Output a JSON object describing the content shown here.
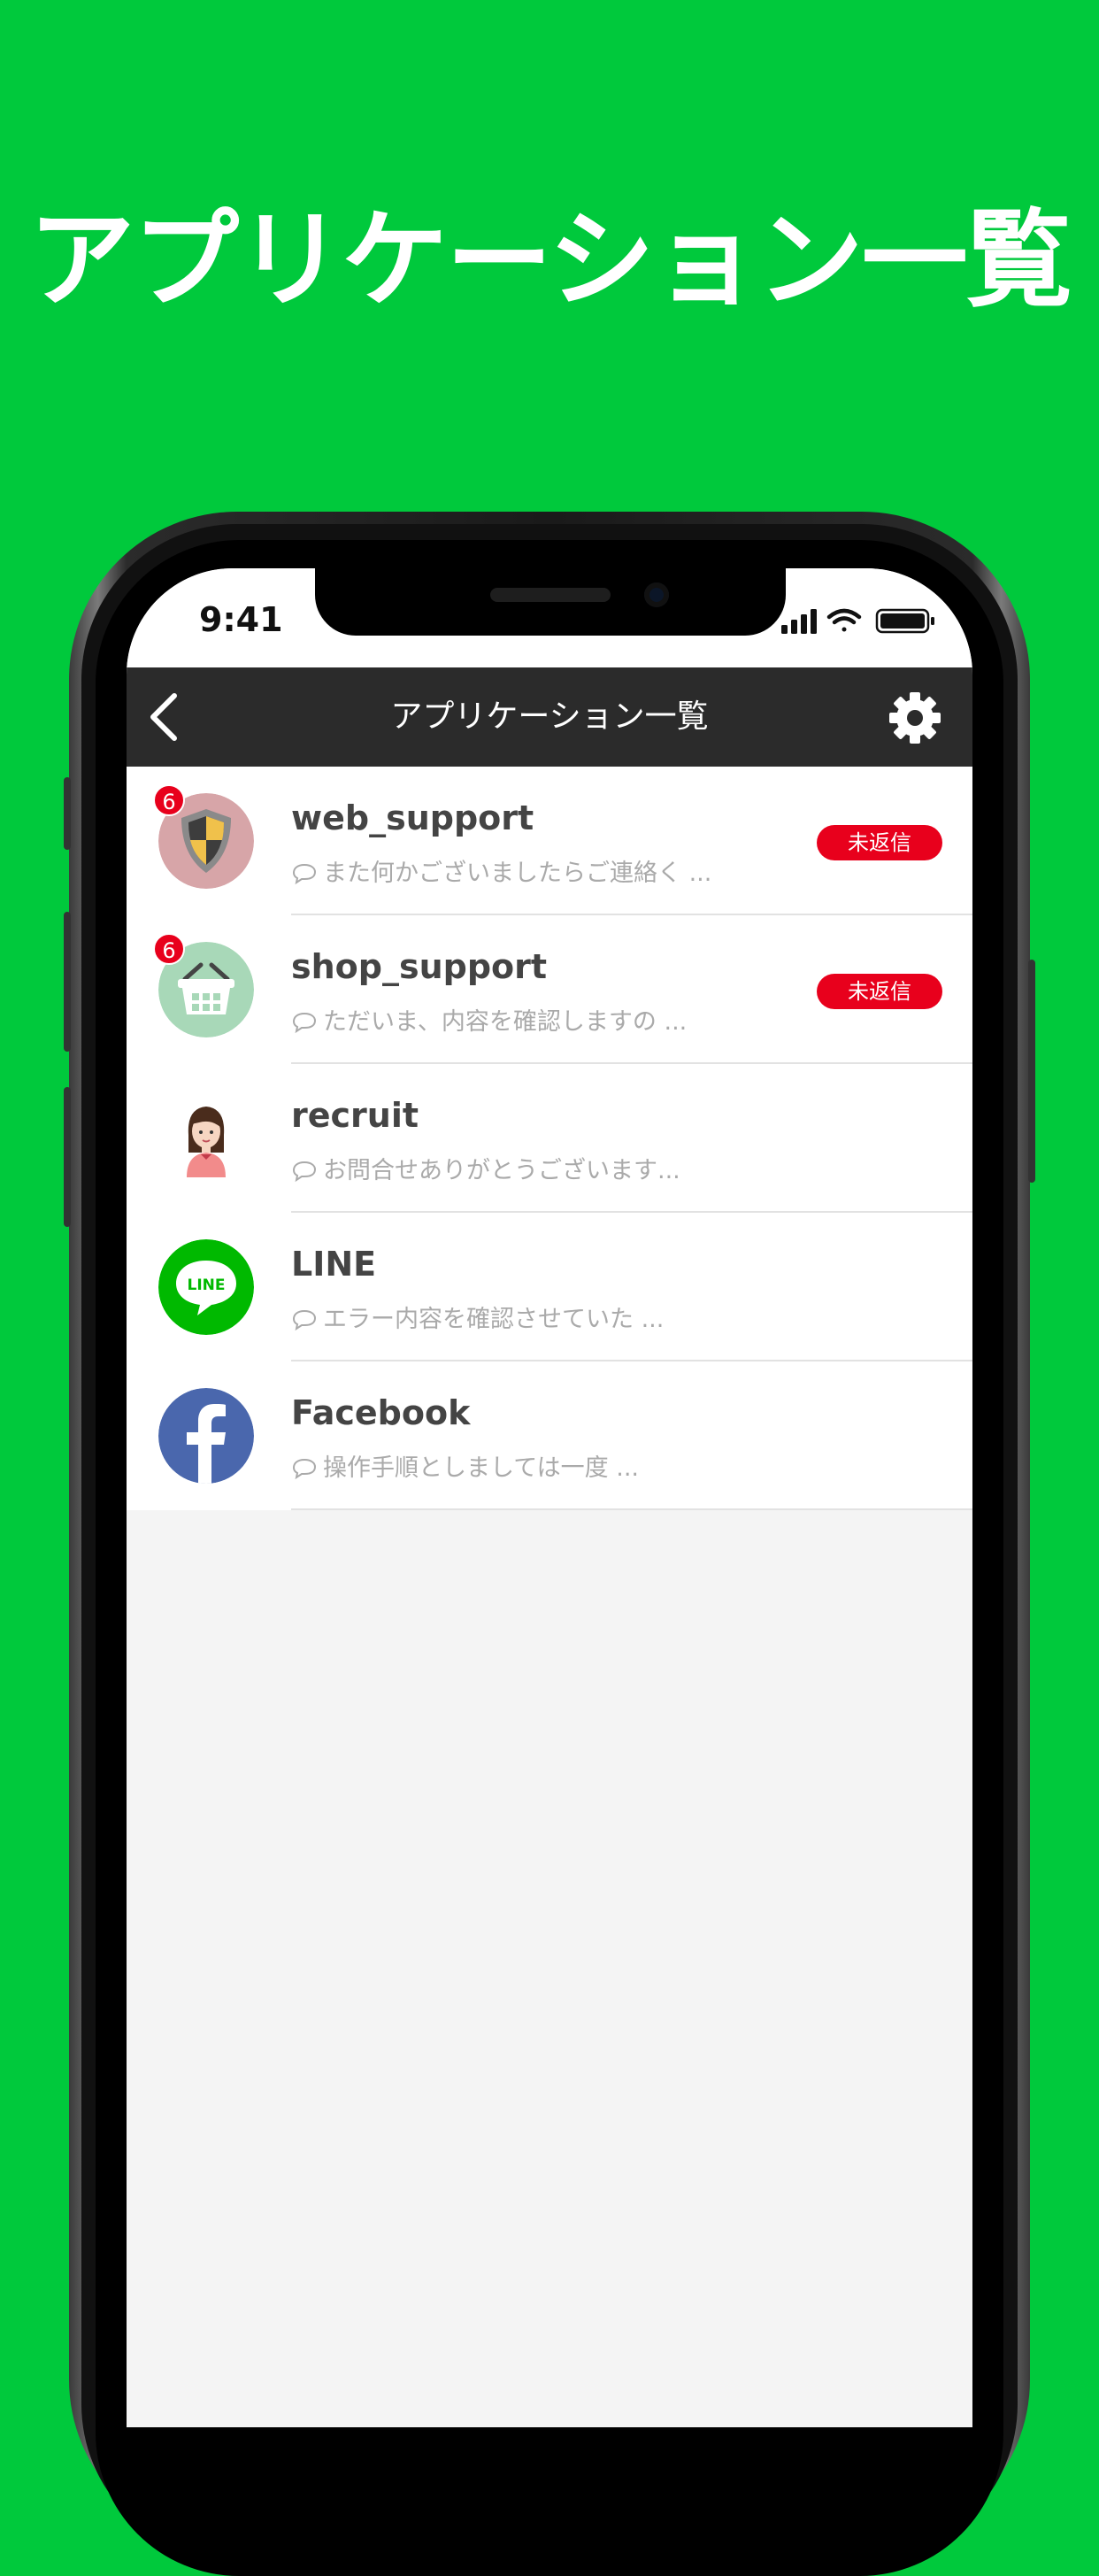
{
  "promo_title": "アプリケーション一覧",
  "status_bar": {
    "time": "9:41"
  },
  "nav": {
    "title": "アプリケーション一覧"
  },
  "colors": {
    "background": "#00c93c",
    "nav": "#2b2b2b",
    "alert": "#e8001c"
  },
  "apps": [
    {
      "name": "web_support",
      "preview": "また何かございましたらご連絡く ...",
      "badge": "6",
      "status": "未返信",
      "icon": "shield-icon"
    },
    {
      "name": "shop_support",
      "preview": "ただいま、内容を確認しますの ...",
      "badge": "6",
      "status": "未返信",
      "icon": "basket-icon"
    },
    {
      "name": "recruit",
      "preview": "お問合せありがとうございます...",
      "badge": "",
      "status": "",
      "icon": "woman-avatar-icon"
    },
    {
      "name": "LINE",
      "preview": "エラー内容を確認させていた ...",
      "badge": "",
      "status": "",
      "icon": "line-logo-icon"
    },
    {
      "name": "Facebook",
      "preview": "操作手順としましては一度 ...",
      "badge": "",
      "status": "",
      "icon": "facebook-logo-icon"
    }
  ],
  "line_logo_text": "LINE"
}
